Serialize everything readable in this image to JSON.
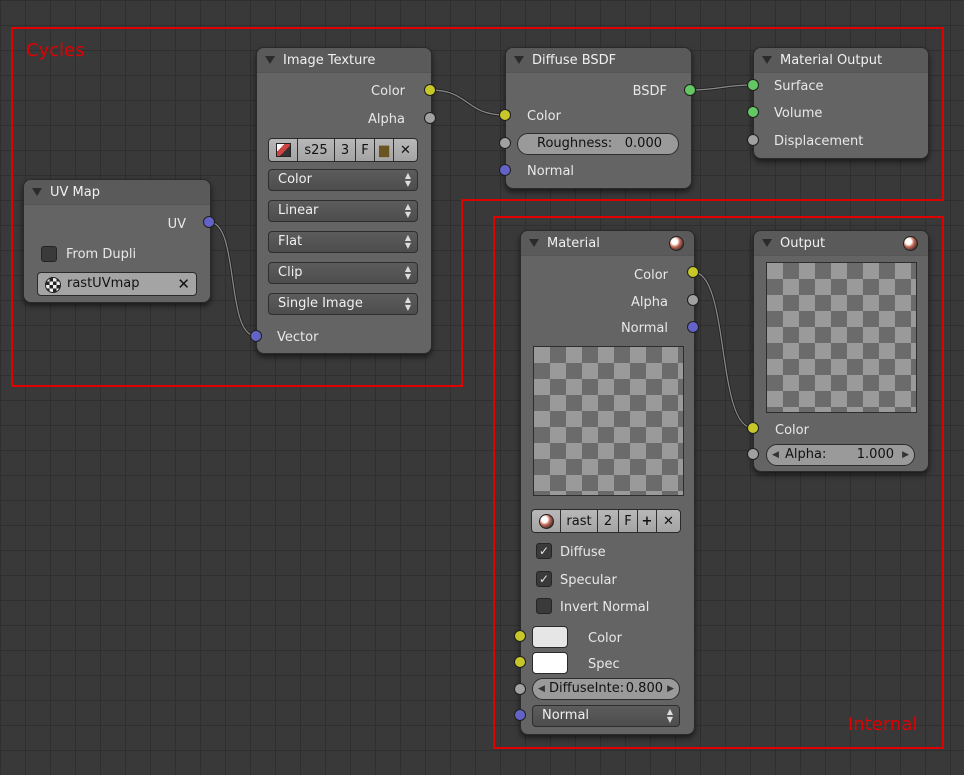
{
  "frames": {
    "cycles_label": "Cycles",
    "internal_label": "Internal",
    "frame_color": "#e10000"
  },
  "socket_colors": {
    "color": "#c7c729",
    "float": "#a1a1a1",
    "vector": "#6363c7",
    "shader": "#63c763"
  },
  "uv_map": {
    "title": "UV Map",
    "out_uv": "UV",
    "from_dupli_label": "From Dupli",
    "from_dupli_checked": false,
    "uv_value": "rastUVmap"
  },
  "image_texture": {
    "title": "Image Texture",
    "out_color": "Color",
    "out_alpha": "Alpha",
    "image_name": "s25",
    "users": "3",
    "fake_user": "F",
    "color_space": "Color",
    "interpolation": "Linear",
    "projection": "Flat",
    "extension": "Clip",
    "source": "Single Image",
    "in_vector": "Vector"
  },
  "diffuse_bsdf": {
    "title": "Diffuse BSDF",
    "out_bsdf": "BSDF",
    "in_color": "Color",
    "roughness_label": "Roughness:",
    "roughness_value": "0.000",
    "in_normal": "Normal"
  },
  "material_output": {
    "title": "Material Output",
    "in_surface": "Surface",
    "in_volume": "Volume",
    "in_displacement": "Displacement"
  },
  "material": {
    "title": "Material",
    "out_color": "Color",
    "out_alpha": "Alpha",
    "out_normal": "Normal",
    "mat_name": "rast",
    "users": "2",
    "fake_user": "F",
    "diffuse_label": "Diffuse",
    "diffuse_checked": true,
    "specular_label": "Specular",
    "specular_checked": true,
    "invert_normal_label": "Invert Normal",
    "invert_normal_checked": false,
    "in_color": "Color",
    "color_value": "#e6e6e6",
    "in_spec": "Spec",
    "spec_value": "#ffffff",
    "diffuse_int_label": "DiffuseInte:",
    "diffuse_int_value": "0.800",
    "normal_select": "Normal"
  },
  "output": {
    "title": "Output",
    "in_color": "Color",
    "alpha_label": "Alpha:",
    "alpha_value": "1.000"
  }
}
